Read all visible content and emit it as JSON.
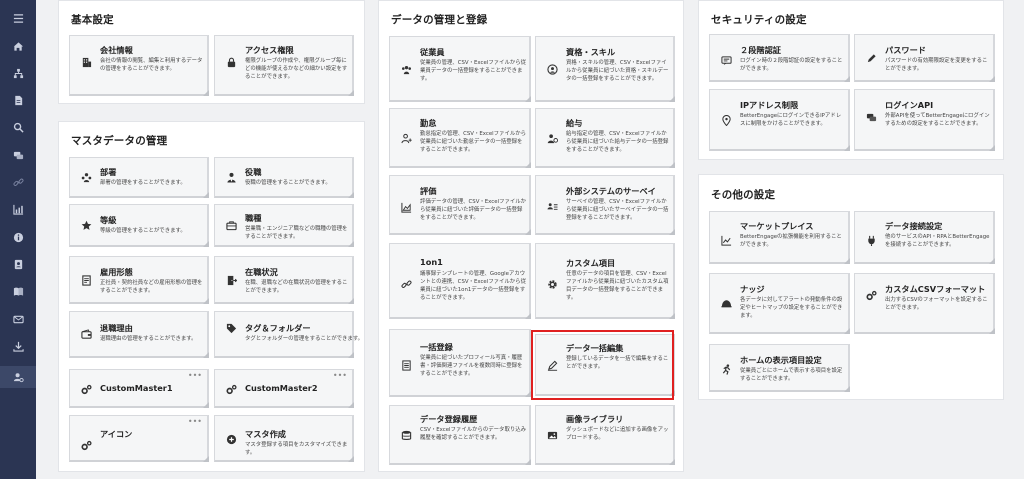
{
  "sidebar": {
    "icons": [
      "menu-icon",
      "home-icon",
      "org-chart-icon",
      "document-icon",
      "search-icon",
      "chat-icon",
      "link-icon",
      "chart-icon",
      "info-icon",
      "contact-card-icon",
      "book-icon",
      "mail-icon",
      "download-icon",
      "user-settings-icon"
    ]
  },
  "panels": {
    "basic": {
      "title": "基本設定"
    },
    "master": {
      "title": "マスタデータの管理"
    },
    "data": {
      "title": "データの管理と登録"
    },
    "security": {
      "title": "セキュリティの設定"
    },
    "other": {
      "title": "その他の設定"
    }
  },
  "cards": {
    "company": {
      "title": "会社情報",
      "desc": "会社の情報の閲覧、編集と利用するデータの管理をすることができます。"
    },
    "access": {
      "title": "アクセス権限",
      "desc": "権限グループの作成や、権限グループ毎にどの機能が使えるかなどの細かい設定をすることができます。"
    },
    "dept": {
      "title": "部署",
      "desc": "部署の管理をすることができます。"
    },
    "position": {
      "title": "役職",
      "desc": "役職の管理をすることができます。"
    },
    "grade": {
      "title": "等級",
      "desc": "等級の管理をすることができます。"
    },
    "jobtype": {
      "title": "職種",
      "desc": "営業職・エンジニア職などの職種の管理をすることができます。"
    },
    "employment": {
      "title": "雇用形態",
      "desc": "正社員・契約社員などの雇用形態の管理をすることができます。"
    },
    "status": {
      "title": "在職状況",
      "desc": "在職、退職などの在職状況の管理をすることができます。"
    },
    "retire": {
      "title": "退職理由",
      "desc": "退職理由の管理をすることができます。"
    },
    "tag": {
      "title": "タグ＆フォルダー",
      "desc": "タグとフォルダーの管理をすることができます。"
    },
    "cm1": {
      "title": "CustomMaster1",
      "dots": "•••"
    },
    "cm2": {
      "title": "CustomMaster2",
      "dots": "•••"
    },
    "icon": {
      "title": "アイコン",
      "dots": "•••"
    },
    "mastercreate": {
      "title": "マスタ作成",
      "desc": "マスタ登録する項目をカスタマイズできます。"
    },
    "employee": {
      "title": "従業員",
      "desc": "従業員の管理、CSV・Excelファイルから従業員データの一括登録をすることができます。"
    },
    "skill": {
      "title": "資格・スキル",
      "desc": "資格・スキルの管理、CSV・Excelファイルから従業員に紐づいた資格・スキルデータの一括登録をすることができます。"
    },
    "attendance": {
      "title": "勤怠",
      "desc": "勤怠指定の管理、CSV・Excelファイルから従業員に紐づいた勤怠データの一括登録をすることができます。"
    },
    "salary": {
      "title": "給与",
      "desc": "給与指定の管理、CSV・Excelファイルから従業員に紐づいた給与データの一括登録をすることができます。"
    },
    "evaluation": {
      "title": "評価",
      "desc": "評価データの管理、CSV・Excelファイルから従業員に紐づいた評価データの一括登録をすることができます。"
    },
    "external": {
      "title": "外部システムのサーベイ",
      "desc": "サーベイの管理、CSV・Excelファイルから従業員に紐づいたサーベイデータの一括登録をすることができます。"
    },
    "oneonone": {
      "title": "1on1",
      "desc": "議事録テンプレートの管理、Googleアカウントとの連携、CSV・Excelファイルから従業員に紐づいた1on1データの一括登録をすることができます。"
    },
    "custom": {
      "title": "カスタム項目",
      "desc": "任意のデータの項目を管理、CSV・Excelファイルから従業員に紐づいたカスタム項目データの一括登録をすることができます。"
    },
    "bulkreg": {
      "title": "一括登録",
      "desc": "従業員に紐づいたプロフィール写真・履歴書・評価関連ファイルを複数同時に登録をすることができます。"
    },
    "bulkedit": {
      "title": "データ一括編集",
      "desc": "登録しているデータを一括で編集をすることができます。"
    },
    "history": {
      "title": "データ登録履歴",
      "desc": "CSV・Excelファイルからのデータ取り込み履歴を確認することができます。"
    },
    "images": {
      "title": "画像ライブラリ",
      "desc": "ダッシュボードなどに追加する画像をアップロードする。"
    },
    "twofa": {
      "title": "２段階認証",
      "desc": "ログイン時の２段階認証の設定をすることができます。"
    },
    "password": {
      "title": "パスワード",
      "desc": "パスワードの有効期限設定を変更をすることができます。"
    },
    "ip": {
      "title": "IPアドレス制限",
      "desc": "BetterEngageにログインできるIPアドレスに制限をかけることができます。"
    },
    "loginapi": {
      "title": "ログインAPI",
      "desc": "外部APIを使ってBetterEngageにログインするための設定をすることができます。"
    },
    "market": {
      "title": "マーケットプレイス",
      "desc": "BetterEngageの拡張機能を利用することができます。"
    },
    "dataconn": {
      "title": "データ接続設定",
      "desc": "他のサービスのAPI・RPAとBetterEngageを接続することができます。"
    },
    "nudge": {
      "title": "ナッジ",
      "desc": "各データに対してアラートの発動条件の設定やヒートマップの設定をすることができます。"
    },
    "csvformat": {
      "title": "カスタムCSVフォーマット",
      "desc": "出力するCSVのフォーマットを設定することができます。"
    },
    "homeitems": {
      "title": "ホームの表示項目設定",
      "desc": "従業員ごとにホームで表示する項目を設定することができます。"
    }
  }
}
